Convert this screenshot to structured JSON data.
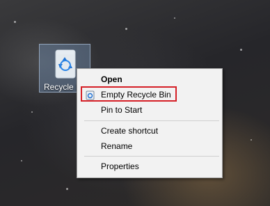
{
  "desktop": {
    "recycle_bin_label": "Recycle Bin"
  },
  "context_menu": {
    "items": [
      {
        "label": "Open",
        "bold": true
      },
      {
        "label": "Empty Recycle Bin",
        "icon": "recycle-bin-icon",
        "highlighted": true
      },
      {
        "label": "Pin to Start"
      },
      {
        "label": "Create shortcut"
      },
      {
        "label": "Rename"
      },
      {
        "label": "Properties"
      }
    ]
  },
  "colors": {
    "highlight_border": "#d51f26",
    "menu_background": "#f2f2f2",
    "icon_selection": "#6e8caf"
  }
}
